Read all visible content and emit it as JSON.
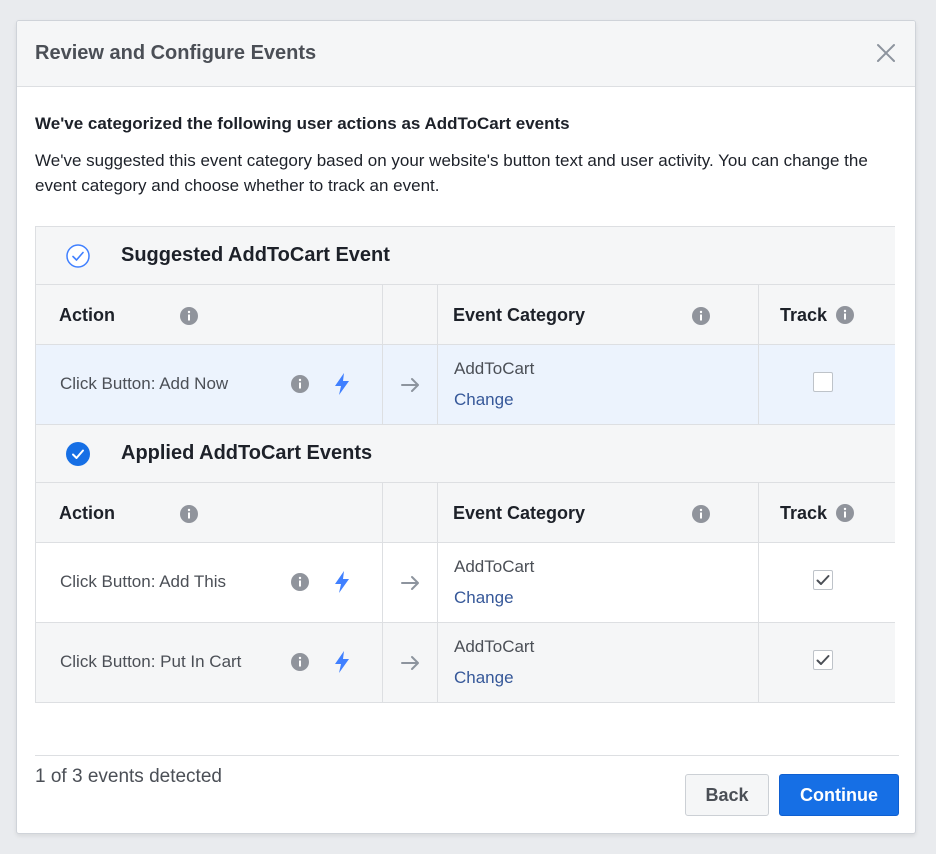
{
  "dialog": {
    "title": "Review and Configure Events",
    "intro_heading": "We've categorized the following user actions as AddToCart events",
    "intro_body": "We've suggested this event category based on your website's button text and user activity. You can change the event category and choose whether to track an event."
  },
  "columns": {
    "action": "Action",
    "event_category": "Event Category",
    "track": "Track"
  },
  "suggested": {
    "title": "Suggested AddToCart Event",
    "checked": false,
    "rows": [
      {
        "action": "Click Button: Add Now",
        "category": "AddToCart",
        "change": "Change",
        "tracked": false
      }
    ]
  },
  "applied": {
    "title": "Applied AddToCart Events",
    "checked": true,
    "rows": [
      {
        "action": "Click Button: Add This",
        "category": "AddToCart",
        "change": "Change",
        "tracked": true
      },
      {
        "action": "Click Button: Put In Cart",
        "category": "AddToCart",
        "change": "Change",
        "tracked": true
      }
    ]
  },
  "footer": {
    "count_text": "1 of 3 events detected",
    "back_label": "Back",
    "continue_label": "Continue"
  },
  "colors": {
    "primary": "#166fe5",
    "link": "#365899",
    "bolt": "#4080ff",
    "highlight_row": "#ecf3fd"
  }
}
